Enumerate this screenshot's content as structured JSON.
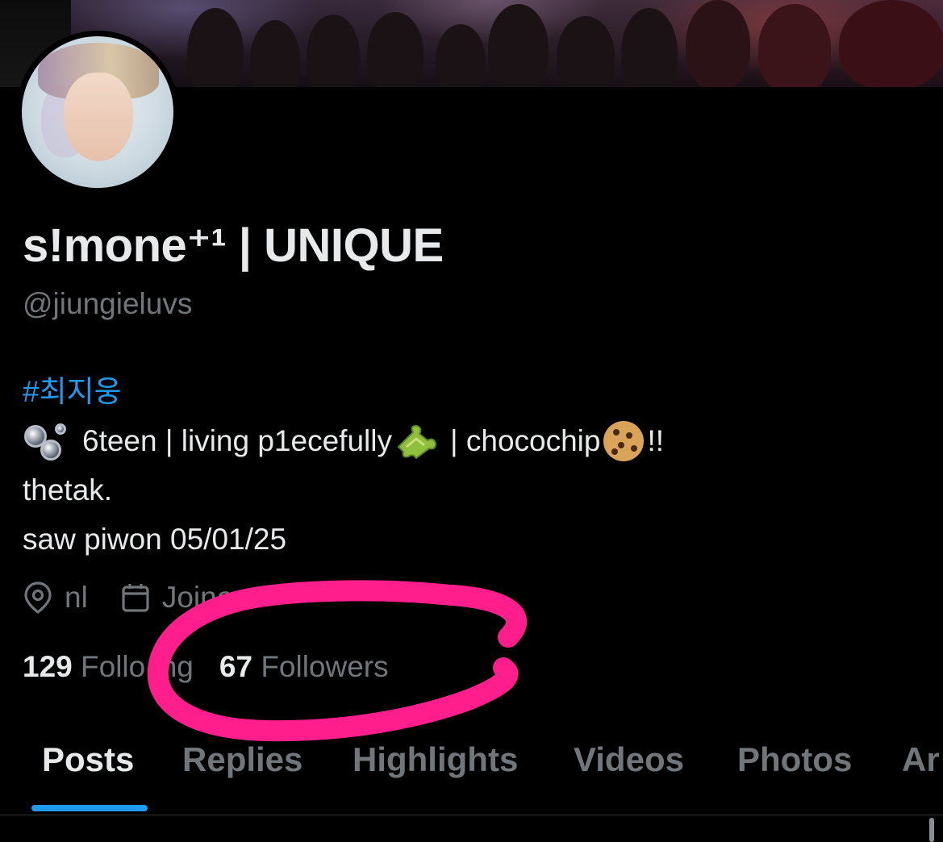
{
  "profile": {
    "display_name": "s!mone⁺¹ | UNIQUE",
    "handle": "@jiungieluvs",
    "hashtag": "#최지웅",
    "bio": {
      "line1_a": "6teen | living p1ecefully",
      "line1_b": " | chocochip",
      "line1_c": "!!",
      "line2": "thetak.",
      "line3": "saw piwon 05/01/25"
    },
    "location": "nl",
    "joined": "Joine"
  },
  "stats": {
    "following_count": "129",
    "following_label": "Follo     ing",
    "followers_count": "67",
    "followers_label": "Followers"
  },
  "tabs": [
    {
      "label": "Posts",
      "active": true
    },
    {
      "label": "Replies",
      "active": false
    },
    {
      "label": "Highlights",
      "active": false
    },
    {
      "label": "Videos",
      "active": false
    },
    {
      "label": "Photos",
      "active": false
    },
    {
      "label": "Ar",
      "active": false
    }
  ],
  "icons": {
    "bio_start": "bubbles-emoji",
    "bio_puzzle": "puzzle-emoji",
    "bio_cookie": "cookie-emoji",
    "location": "location-pin-icon",
    "joined": "calendar-icon"
  },
  "colors": {
    "background": "#000000",
    "text": "#e7e9ea",
    "muted": "#71767b",
    "accent": "#1d9bf0",
    "annotation": "#ff1e8c"
  }
}
